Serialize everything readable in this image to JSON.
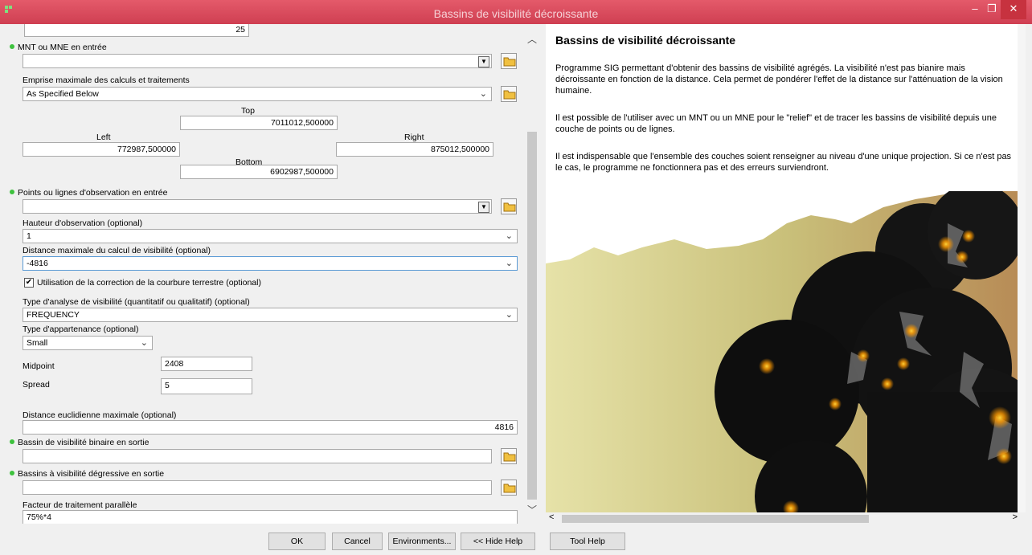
{
  "window": {
    "title": "Bassins de visibilité décroissante",
    "minimize": "–",
    "maximize": "❐",
    "close": "✕"
  },
  "form": {
    "top_value": "25",
    "mnt_label": "MNT ou MNE en entrée",
    "mnt_value": "",
    "extent_label": "Emprise maximale des calculs et traitements",
    "extent_value": "As Specified Below",
    "top_label": "Top",
    "top_extent": "7011012,500000",
    "left_label": "Left",
    "left_extent": "772987,500000",
    "right_label": "Right",
    "right_extent": "875012,500000",
    "bottom_label": "Bottom",
    "bottom_extent": "6902987,500000",
    "points_label": "Points ou lignes d'observation en entrée",
    "points_value": "",
    "hauteur_label": "Hauteur d'observation (optional)",
    "hauteur_value": "1",
    "distance_label": "Distance maximale du calcul de visibilité (optional)",
    "distance_value": "-4816",
    "curvature_label": "Utilisation de la correction de la courbure terrestre (optional)",
    "curvature_checked": "✔",
    "type_analyse_label": "Type d'analyse de visibilité (quantitatif ou qualitatif) (optional)",
    "type_analyse_value": "FREQUENCY",
    "appartenance_label": "Type d'appartenance (optional)",
    "appartenance_value": "Small",
    "midpoint_label": "Midpoint",
    "midpoint_value": "2408",
    "spread_label": "Spread",
    "spread_value": "5",
    "euclid_label": "Distance euclidienne maximale (optional)",
    "euclid_value": "4816",
    "binaire_label": "Bassin de visibilité binaire en sortie",
    "binaire_value": "",
    "degressive_label": "Bassins à visibilité dégressive en sortie",
    "degressive_value": "",
    "facteur_label": "Facteur de traitement parallèle",
    "facteur_value": "75%*4"
  },
  "help": {
    "title": "Bassins de visibilité décroissante",
    "p1": "Programme SIG permettant d'obtenir des bassins de visibilité agrégés. La visibilité n'est pas bianire mais décroissante en fonction de la distance. Cela permet de pondérer l'effet de la distance sur l'atténuation de la vision humaine.",
    "p2": "Il est possible de l'utiliser avec un MNT ou un MNE pour le \"relief\" et de tracer les bassins de visibilité depuis une couche de points ou de lignes.",
    "p3": "Il est indispensable que l'ensemble des couches soient renseigner au niveau d'une unique projection. Si ce n'est pas le cas, le programme ne fonctionnera pas et des erreurs surviendront."
  },
  "buttons": {
    "ok": "OK",
    "cancel": "Cancel",
    "environments": "Environments...",
    "hide_help": "<< Hide Help",
    "tool_help": "Tool Help"
  },
  "colors": {
    "titlebar": "#d84a5c",
    "required_dot": "#3ec23e"
  }
}
